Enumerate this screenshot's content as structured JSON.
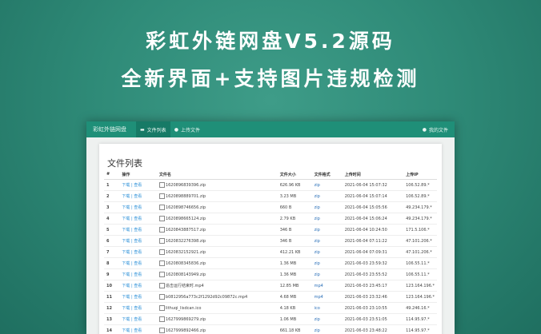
{
  "banner": {
    "title": "彩虹外链网盘V5.2源码",
    "subtitle": "全新界面+支持图片违规检测"
  },
  "navbar": {
    "brand": "彩虹外链网盘",
    "items": [
      {
        "label": "文件列表",
        "icon": "folder-icon",
        "active": true
      },
      {
        "label": "上传文件",
        "icon": "user-icon",
        "active": false
      }
    ],
    "right_label": "我的文件"
  },
  "panel": {
    "title": "文件列表",
    "columns": [
      "#",
      "操作",
      "文件名",
      "文件大小",
      "文件格式",
      "上传时间",
      "上传IP"
    ],
    "rows": [
      {
        "num": "1",
        "op": "下载 | 查看",
        "name": "1620896839396.zip",
        "size": "626.96 KB",
        "type": "zip",
        "time": "2021-06-04 15:07:32",
        "ip": "106.52.89.*"
      },
      {
        "num": "2",
        "op": "下载 | 查看",
        "name": "1620898889701.zip",
        "size": "3.23 MB",
        "type": "zip",
        "time": "2021-06-04 15:07:14",
        "ip": "106.52.89.*"
      },
      {
        "num": "3",
        "op": "下载 | 查看",
        "name": "1620898746656.zip",
        "size": "660 B",
        "type": "zip",
        "time": "2021-06-04 15:05:56",
        "ip": "49.234.179.*"
      },
      {
        "num": "4",
        "op": "下载 | 查看",
        "name": "1620898665124.zip",
        "size": "2.79 KB",
        "type": "zip",
        "time": "2021-06-04 15:06:24",
        "ip": "49.234.179.*"
      },
      {
        "num": "5",
        "op": "下载 | 查看",
        "name": "1620843887517.zip",
        "size": "346 B",
        "type": "zip",
        "time": "2021-06-04 10:24:50",
        "ip": "171.5.106.*"
      },
      {
        "num": "6",
        "op": "下载 | 查看",
        "name": "1620832276398.zip",
        "size": "346 B",
        "type": "zip",
        "time": "2021-06-04 07:11:22",
        "ip": "47.101.206.*"
      },
      {
        "num": "7",
        "op": "下载 | 查看",
        "name": "1620832152921.zip",
        "size": "412.21 KB",
        "type": "zip",
        "time": "2021-06-04 07:09:31",
        "ip": "47.101.206.*"
      },
      {
        "num": "8",
        "op": "下载 | 查看",
        "name": "1620808345836.zip",
        "size": "1.36 MB",
        "type": "zip",
        "time": "2021-06-03 23:59:32",
        "ip": "106.55.11.*"
      },
      {
        "num": "9",
        "op": "下载 | 查看",
        "name": "1620808143949.zip",
        "size": "1.36 MB",
        "type": "zip",
        "time": "2021-06-03 23:55:52",
        "ip": "106.55.11.*"
      },
      {
        "num": "10",
        "op": "下载 | 查看",
        "name": "追击运行结束时.mp4",
        "size": "12.85 MB",
        "type": "mp4",
        "time": "2021-06-03 23:45:17",
        "ip": "123.164.196.*"
      },
      {
        "num": "11",
        "op": "下载 | 查看",
        "name": "b0812956a773c2f1292d92c09872c.mp4",
        "size": "4.68 MB",
        "type": "mp4",
        "time": "2021-06-03 23:32:46",
        "ip": "123.164.196.*"
      },
      {
        "num": "12",
        "op": "下载 | 查看",
        "name": "lithuqi_lisdcan.ico",
        "size": "4.18 KB",
        "type": "ico",
        "time": "2021-06-03 23:10:55",
        "ip": "49.246.16.*"
      },
      {
        "num": "13",
        "op": "下载 | 查看",
        "name": "1627999869279.zip",
        "size": "1.06 MB",
        "type": "zip",
        "time": "2021-06-03 23:51:05",
        "ip": "114.95.97.*"
      },
      {
        "num": "14",
        "op": "下载 | 查看",
        "name": "1627999892466.zip",
        "size": "661.18 KB",
        "type": "zip",
        "time": "2021-06-03 23:48:22",
        "ip": "114.95.97.*"
      }
    ]
  }
}
